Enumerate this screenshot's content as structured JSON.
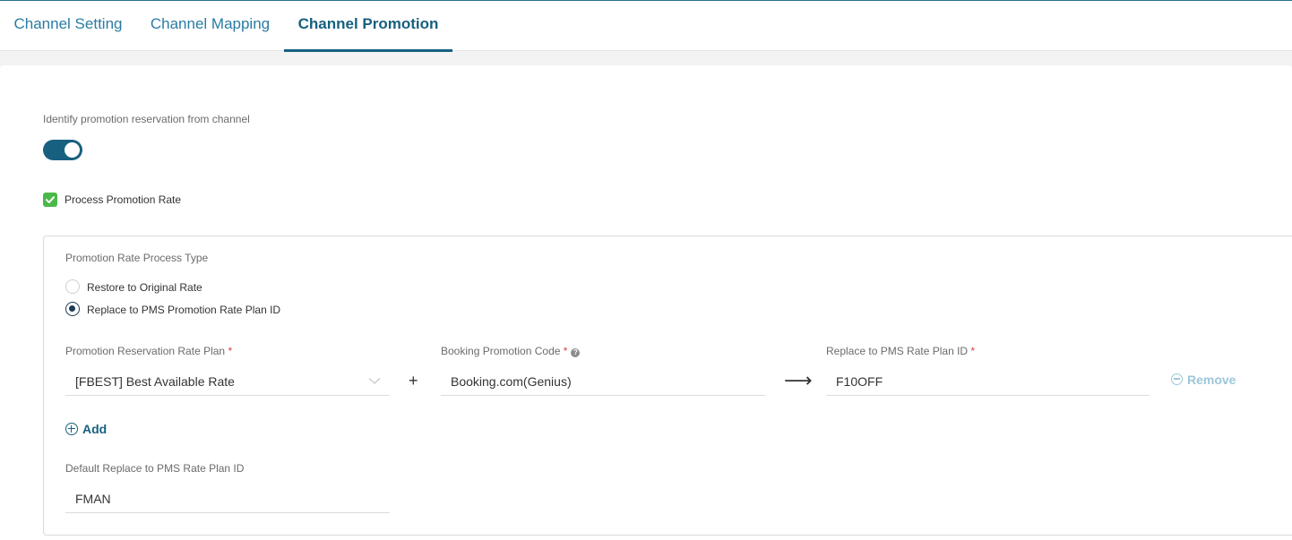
{
  "tabs": [
    {
      "label": "Channel Setting",
      "active": false
    },
    {
      "label": "Channel Mapping",
      "active": false
    },
    {
      "label": "Channel Promotion",
      "active": true
    }
  ],
  "identify": {
    "label": "Identify promotion reservation from channel",
    "toggle_on": true
  },
  "process_promotion": {
    "label": "Process Promotion Rate",
    "checked": true
  },
  "process_type": {
    "label": "Promotion Rate Process Type",
    "options": [
      {
        "label": "Restore to Original Rate",
        "checked": false
      },
      {
        "label": "Replace to PMS Promotion Rate Plan ID",
        "checked": true
      }
    ]
  },
  "mapping_row": {
    "rate_plan_label": "Promotion Reservation Rate Plan",
    "rate_plan_value": "[FBEST] Best Available Rate",
    "plus": "+",
    "promo_code_label": "Booking Promotion Code",
    "promo_code_value": "Booking.com(Genius)",
    "help_icon": "?",
    "arrow": "⟶",
    "pms_label": "Replace to PMS Rate Plan ID",
    "pms_value": "F10OFF",
    "required_mark": "*",
    "remove_label": "Remove"
  },
  "add_label": "Add",
  "default_pms": {
    "label": "Default Replace to PMS Rate Plan ID",
    "value": "FMAN"
  },
  "colors": {
    "accent": "#17607f",
    "tab_text": "#2a7ca3",
    "check_green": "#4ab94a",
    "required_red": "#e03b3b",
    "remove_disabled": "#9cc7da"
  }
}
